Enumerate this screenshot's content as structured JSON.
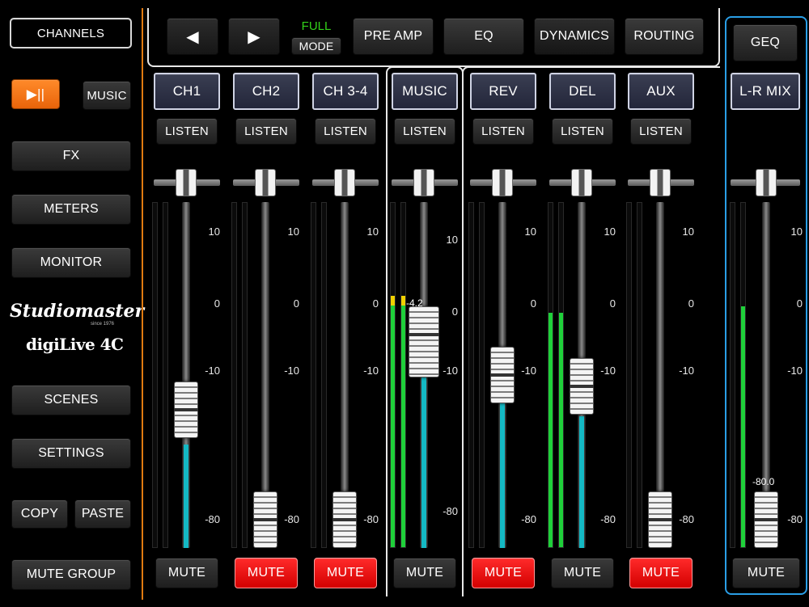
{
  "sidebar": {
    "channels": "CHANNELS",
    "play_pause": "▶||",
    "music": "MUSIC",
    "fx": "FX",
    "meters": "METERS",
    "monitor": "MONITOR",
    "brand": "Studiomaster",
    "brand_since": "since 1976",
    "model": "digiLive 4C",
    "scenes": "SCENES",
    "settings": "SETTINGS",
    "copy": "COPY",
    "paste": "PASTE",
    "mute_group": "MUTE GROUP"
  },
  "topbar": {
    "prev": "◀",
    "next": "▶",
    "full": "FULL",
    "mode": "MODE",
    "preamp": "PRE AMP",
    "eq": "EQ",
    "dynamics": "DYNAMICS",
    "routing": "ROUTING",
    "geq": "GEQ"
  },
  "colors": {
    "full_text": "#33d21a",
    "left_divider": "#e07a10",
    "right_divider": "#2a9ee6",
    "mute_active": "#ff1a1a",
    "meter": "#1fd03a",
    "fader_level": "#14b9c4"
  },
  "scale_labels": [
    "10",
    "0",
    "-10",
    "-80"
  ],
  "channels": [
    {
      "name": "CH1",
      "listen": "LISTEN",
      "mute": "MUTE",
      "muted": false,
      "fader": 0.38,
      "meter_l": 0,
      "meter_r": 0,
      "readout": ""
    },
    {
      "name": "CH2",
      "listen": "LISTEN",
      "mute": "MUTE",
      "muted": true,
      "fader": 0.0,
      "meter_l": 0,
      "meter_r": 0,
      "readout": ""
    },
    {
      "name": "CH 3-4",
      "listen": "LISTEN",
      "mute": "MUTE",
      "muted": true,
      "fader": 0.0,
      "meter_l": 0,
      "meter_r": 0,
      "readout": ""
    },
    {
      "name": "MUSIC",
      "listen": "LISTEN",
      "mute": "MUTE",
      "muted": false,
      "fader": 0.62,
      "meter_l": 0.73,
      "meter_r": 0.73,
      "readout": "-4.2"
    },
    {
      "name": "REV",
      "listen": "LISTEN",
      "mute": "MUTE",
      "muted": true,
      "fader": 0.5,
      "meter_l": 0,
      "meter_r": 0,
      "readout": ""
    },
    {
      "name": "DEL",
      "listen": "LISTEN",
      "mute": "MUTE",
      "muted": false,
      "fader": 0.46,
      "meter_l": 0.68,
      "meter_r": 0.68,
      "readout": ""
    },
    {
      "name": "AUX",
      "listen": "LISTEN",
      "mute": "MUTE",
      "muted": true,
      "fader": 0.0,
      "meter_l": 0,
      "meter_r": 0,
      "readout": ""
    }
  ],
  "master": {
    "name": "L-R MIX",
    "mute": "MUTE",
    "muted": false,
    "fader": 0.0,
    "meter": 0.7,
    "readout": "-80.0"
  }
}
